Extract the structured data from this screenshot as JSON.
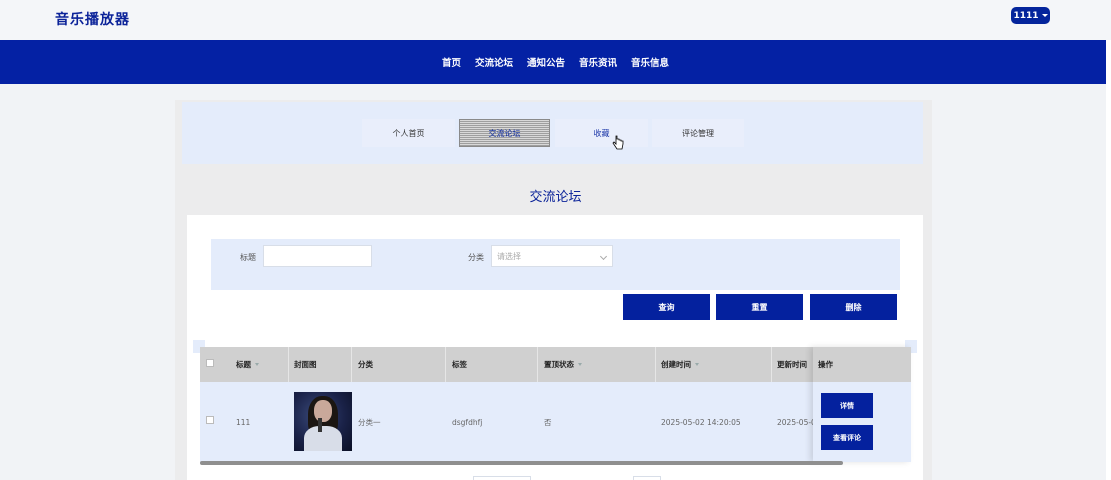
{
  "header": {
    "brand": "音乐播放器",
    "user": "1111"
  },
  "nav": {
    "items": [
      "首页",
      "交流论坛",
      "通知公告",
      "音乐资讯",
      "音乐信息"
    ]
  },
  "subnav": {
    "tabs": [
      "个人首页",
      "交流论坛",
      "收藏",
      "评论管理"
    ],
    "active": "交流论坛"
  },
  "page": {
    "title": "交流论坛"
  },
  "search": {
    "title_label": "标题",
    "title_value": "",
    "category_label": "分类",
    "category_placeholder": "请选择"
  },
  "actions": {
    "query": "查询",
    "reset": "重置",
    "delete": "删除"
  },
  "table": {
    "columns": [
      "标题",
      "封面图",
      "分类",
      "标签",
      "置顶状态",
      "创建时间",
      "更新时间",
      "操作"
    ],
    "rows": [
      {
        "title": "111",
        "cover": "cover-photo-singer",
        "category": "分类一",
        "tag": "dsgfdhfj",
        "pinned": "否",
        "created": "2025-05-02 14:20:05",
        "updated": "2025-05-0",
        "btn_detail": "详情",
        "btn_comments": "查看评论"
      }
    ]
  },
  "colors": {
    "primary": "#0421a4",
    "light_panel": "#e4ecfb",
    "header_bg": "#d0d0d0"
  }
}
